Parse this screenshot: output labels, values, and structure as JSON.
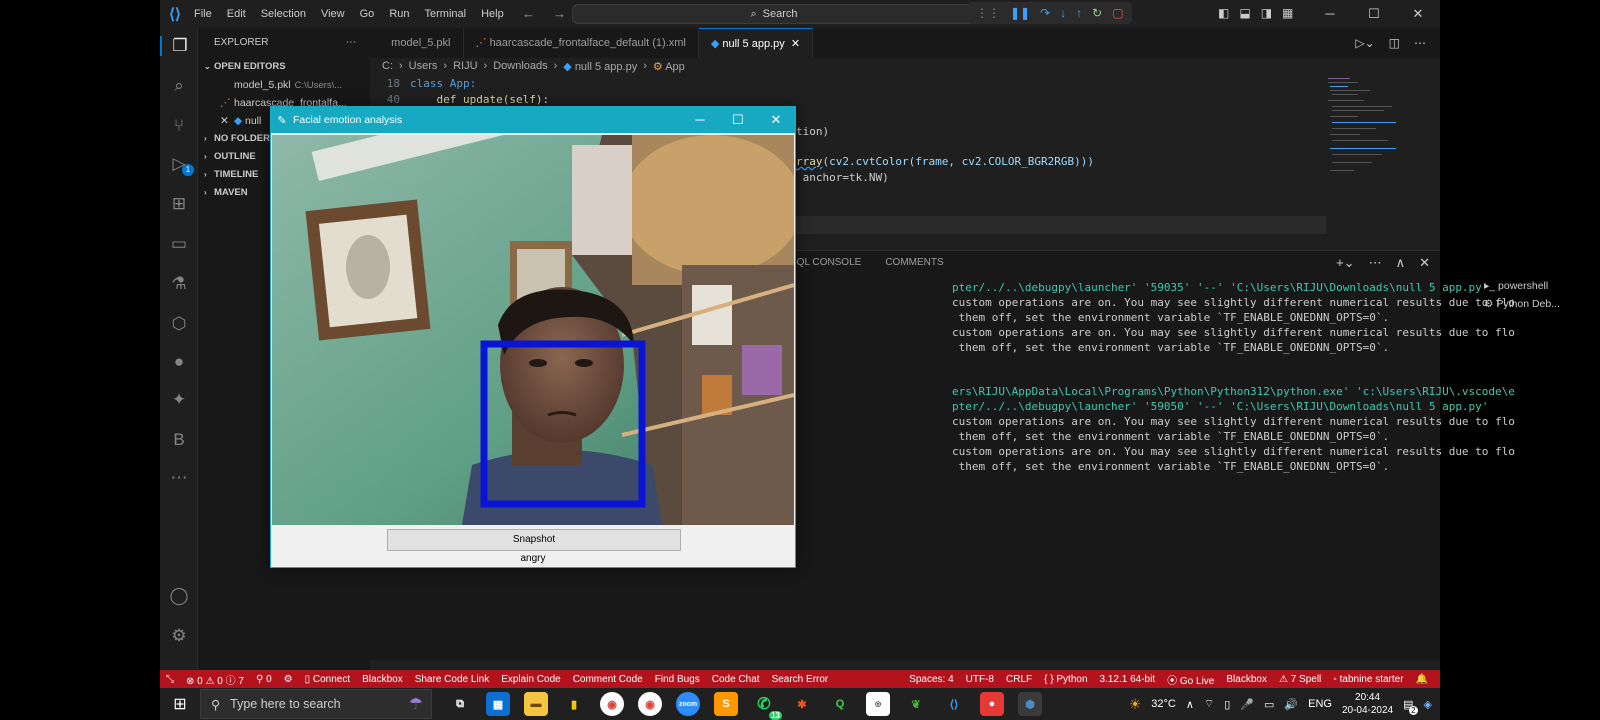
{
  "menu": [
    "File",
    "Edit",
    "Selection",
    "View",
    "Go",
    "Run",
    "Terminal",
    "Help"
  ],
  "search": {
    "label": "Search"
  },
  "explorer": {
    "title": "EXPLORER",
    "open_editors": "OPEN EDITORS",
    "items": [
      {
        "name": "model_5.pkl",
        "path": "C:\\Users\\..."
      },
      {
        "name": "haarcascade_frontalfa...",
        "path": ""
      },
      {
        "name": "null",
        "path": ""
      }
    ],
    "sections": [
      "NO FOLDER O",
      "OUTLINE",
      "TIMELINE",
      "MAVEN"
    ]
  },
  "tabs": [
    "model_5.pkl",
    "haarcascade_frontalface_default (1).xml",
    "null 5 app.py"
  ],
  "breadcrumb": [
    "C:",
    "Users",
    "RIJU",
    "Downloads",
    "null 5 app.py",
    "App"
  ],
  "code": {
    "line18_num": "18",
    "line18": "class App:",
    "line40_num": "40",
    "line40": "    def update(self):",
    "frag1": "tion)",
    "frag2_a": "rray",
    "frag2_b": "(cv2.cvtColor(frame, cv2.COLOR_BGR2RGB)))",
    "frag3": " anchor=tk.NW)"
  },
  "panel": {
    "tabs": [
      "SQL CONSOLE",
      "COMMENTS"
    ],
    "terminal_lines": [
      "pter/../..\\debugpy\\launcher' '59035' '--' 'C:\\Users\\RIJU\\Downloads\\null 5 app.py'",
      "custom operations are on. You may see slightly different numerical results due to flo",
      " them off, set the environment variable `TF_ENABLE_ONEDNN_OPTS=0`.",
      "custom operations are on. You may see slightly different numerical results due to flo",
      " them off, set the environment variable `TF_ENABLE_ONEDNN_OPTS=0`.",
      "",
      "",
      "ers\\RIJU\\AppData\\Local\\Programs\\Python\\Python312\\python.exe' 'c:\\Users\\RIJU\\.vscode\\e",
      "pter/../..\\debugpy\\launcher' '59050' '--' 'C:\\Users\\RIJU\\Downloads\\null 5 app.py'",
      "custom operations are on. You may see slightly different numerical results due to flo",
      " them off, set the environment variable `TF_ENABLE_ONEDNN_OPTS=0`.",
      "custom operations are on. You may see slightly different numerical results due to flo",
      " them off, set the environment variable `TF_ENABLE_ONEDNN_OPTS=0`."
    ],
    "terminals": [
      "powershell",
      "Python Deb..."
    ]
  },
  "status": {
    "errors": "0",
    "warnings": "0",
    "info": "7",
    "ports": "0",
    "left_items": [
      "Connect",
      "Blackbox",
      "Share Code Link",
      "Explain Code",
      "Comment Code",
      "Find Bugs",
      "Code Chat",
      "Search Error"
    ],
    "right_items": [
      "Spaces: 4",
      "UTF-8",
      "CRLF",
      "Python",
      "3.12.1 64-bit",
      "Go Live",
      "Blackbox",
      "7 Spell",
      "tabnine starter"
    ]
  },
  "app": {
    "title": "Facial emotion analysis",
    "snapshot_label": "Snapshot",
    "emotion": "angry"
  },
  "taskbar": {
    "search_placeholder": "Type here to search",
    "weather": "32°C",
    "lang": "ENG",
    "time": "20:44",
    "date": "20-04-2024",
    "notifications": "2",
    "whatsapp_badge": "13"
  },
  "colors": {
    "statusbar": "#b3131c",
    "app_titlebar": "#17a8c2",
    "face_box": "#0a14d8"
  }
}
